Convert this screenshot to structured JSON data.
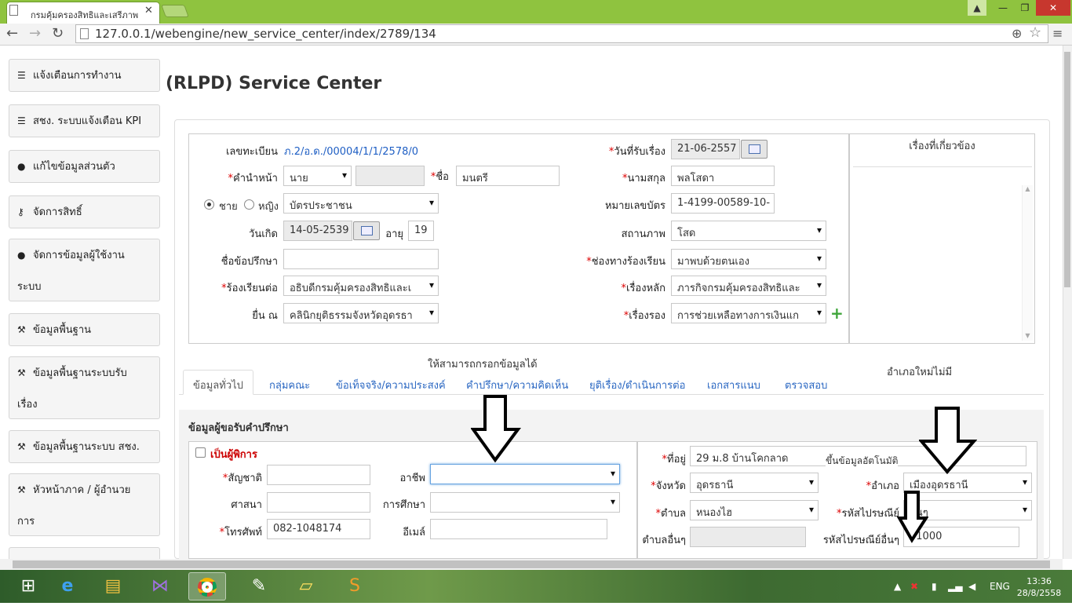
{
  "browser": {
    "tab_title": "กรมคุ้มครองสิทธิและเสรีภาพ",
    "url": "127.0.0.1/webengine/new_service_center/index/2789/134"
  },
  "sidebar": {
    "items": [
      {
        "label": "แจ้งเตือนการทำงาน",
        "icon": "list-icon"
      },
      {
        "label": "สชง. ระบบแจ้งเตือน KPI",
        "icon": "list-icon"
      },
      {
        "label": "แก้ไขข้อมูลส่วนตัว",
        "icon": "user-icon"
      },
      {
        "label": "จัดการสิทธิ์",
        "icon": "key-icon"
      },
      {
        "label": "จัดการข้อมูลผู้ใช้งาน",
        "label2": "ระบบ",
        "icon": "user-icon"
      },
      {
        "label": "ข้อมูลพื้นฐาน",
        "icon": "wrench-icon"
      },
      {
        "label": "ข้อมูลพื้นฐานระบบรับ",
        "label2": "เรื่อง",
        "icon": "wrench-icon"
      },
      {
        "label": "ข้อมูลพื้นฐานระบบ สชง.",
        "icon": "wrench-icon"
      },
      {
        "label": "หัวหน้าภาค / ผู้อำนวย",
        "label2": "การ",
        "icon": "wrench-icon"
      }
    ]
  },
  "page_title": "(RLPD) Service Center",
  "form": {
    "reg_no_label": "เลขทะเบียน",
    "reg_no": "ภ.2/อ.ด./00004/1/1/2578/0",
    "prefix_label": "คำนำหน้า",
    "prefix": "นาย",
    "name_label": "ชื่อ",
    "name": "มนตรี",
    "gender_male": "ชาย",
    "gender_female": "หญิง",
    "id_type": "บัตรประชาชน",
    "dob_label": "วันเกิด",
    "dob": "14-05-2539",
    "age_label": "อายุ",
    "age": "19",
    "topic_label": "ชื่อข้อปรึกษา",
    "topic": "",
    "complain_to_label": "ร้องเรียนต่อ",
    "complain_to": "อธิบดีกรมคุ้มครองสิทธิและเ",
    "submit_at_label": "ยื่น ณ",
    "submit_at": "คลินิกยุติธรรมจังหวัดอุดรธา",
    "received_date_label": "วันที่รับเรื่อง",
    "received_date": "21-06-2557",
    "surname_label": "นามสกุล",
    "surname": "พลโสดา",
    "card_no_label": "หมายเลขบัตร",
    "card_no": "1-4199-00589-10-",
    "status_label": "สถานภาพ",
    "status": "โสด",
    "channel_label": "ช่องทางร้องเรียน",
    "channel": "มาพบด้วยตนเอง",
    "main_matter_label": "เรื่องหลัก",
    "main_matter": "ภารกิจกรมคุ้มครองสิทธิและ",
    "sub_matter_label": "เรื่องรอง",
    "sub_matter": "การช่วยเหลือทางการเงินแก"
  },
  "related_title": "เรื่องที่เกี่ยวข้อง",
  "annotations": {
    "note1": "ให้สามารถกรอกข้อมูลได้",
    "note2": "อำเภอใหม่ไม่มี",
    "note3": "ขึ้นข้อมูลอัตโนมัติ"
  },
  "tabs": [
    "ข้อมูลทั่วไป",
    "กลุ่มคณะ",
    "ข้อเท็จจริง/ความประสงค์",
    "คำปรึกษา/ความคิดเห็น",
    "ยุติเรื่อง/ดำเนินการต่อ",
    "เอกสารแนบ",
    "ตรวจสอบ"
  ],
  "section": {
    "title": "ข้อมูลผู้ขอรับคำปรึกษา",
    "disabled_label": "เป็นผู้พิการ",
    "nationality_label": "สัญชาติ",
    "nationality": "",
    "religion_label": "ศาสนา",
    "religion": "",
    "phone_label": "โทรศัพท์",
    "phone": "082-1048174",
    "occupation_label": "อาชีพ",
    "occupation": "",
    "education_label": "การศึกษา",
    "education": "",
    "email_label": "อีเมล์",
    "email": "",
    "address_label": "ที่อยู่",
    "address": "29 ม.8 บ้านโคกลาด",
    "province_label": "จังหวัด",
    "province": "อุดรธานี",
    "district_label": "อำเภอ",
    "district": "เมืองอุดรธานี",
    "subdistrict_label": "ตำบล",
    "subdistrict": "หนองไฮ",
    "postcode_label": "รหัสไปรษณีย์",
    "postcode": "อื่นๆ",
    "other_subdistrict_label": "ตำบลอื่นๆ",
    "other_subdistrict": "",
    "other_postcode_label": "รหัสไปรษณีย์อื่นๆ",
    "other_postcode": "41000"
  },
  "taskbar": {
    "lang": "ENG",
    "time": "13:36",
    "date": "28/8/2558"
  },
  "colors": {
    "chrome_green": "#8fc33f",
    "required": "#dd0000",
    "link": "#1f5fc4",
    "disabled_red": "#cc0000"
  }
}
